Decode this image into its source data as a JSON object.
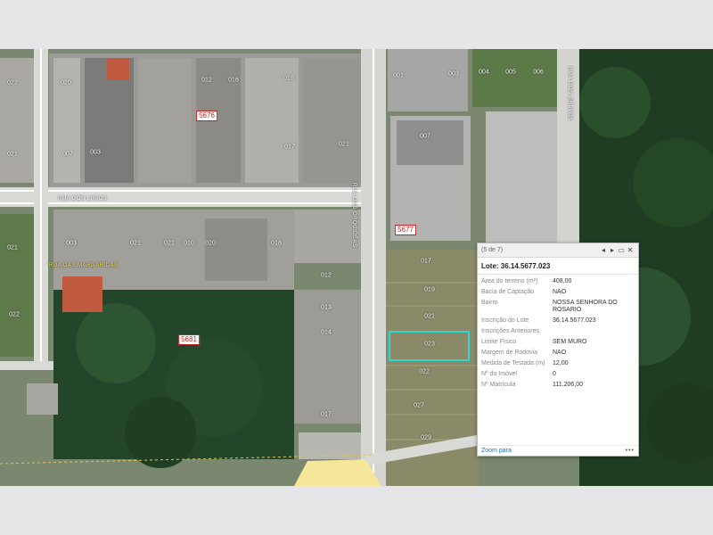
{
  "map": {
    "blocks": [
      "5676",
      "5677",
      "5681"
    ],
    "lots": [
      "022",
      "020",
      "012",
      "016",
      "018",
      "021",
      "017",
      "021",
      "007",
      "003",
      "004",
      "005",
      "006",
      "001",
      "007",
      "003",
      "021",
      "003",
      "022",
      "021",
      "021",
      "010",
      "018",
      "012",
      "020",
      "019",
      "023",
      "021",
      "022",
      "029",
      "014",
      "013",
      "017",
      "017",
      "027"
    ],
    "streets": [
      "RUA DOS LIRIOS",
      "RUA DAS ORQUIDEAS",
      "RUA DOS CRAVOS",
      "RUA DAS MARGARIDAS"
    ]
  },
  "popup": {
    "counter": "(5 de 7)",
    "controls": {
      "prev": "◂",
      "next": "▸",
      "dock": "▭",
      "close": "✕"
    },
    "title": "Lote: 36.14.5677.023",
    "fields": [
      {
        "label": "Área do terreno (m²)",
        "value": "408,00"
      },
      {
        "label": "Bacia de Captação",
        "value": "NAO"
      },
      {
        "label": "Bairro",
        "value": "NOSSA SENHORA DO ROSARIO"
      },
      {
        "label": "Inscrição do Lote",
        "value": "36.14.5677.023"
      },
      {
        "label": "Inscrições Anteriores",
        "value": ""
      },
      {
        "label": "Limite Físico",
        "value": "SEM MURO"
      },
      {
        "label": "Margem de Rodovia",
        "value": "NAO"
      },
      {
        "label": "Medida de Testada (m)",
        "value": "12,00"
      },
      {
        "label": "Nº do Imóvel",
        "value": "0"
      },
      {
        "label": "Nº Matrícula",
        "value": "111.206,00"
      }
    ],
    "zoom_label": "Zoom para",
    "more_label": "•••"
  }
}
